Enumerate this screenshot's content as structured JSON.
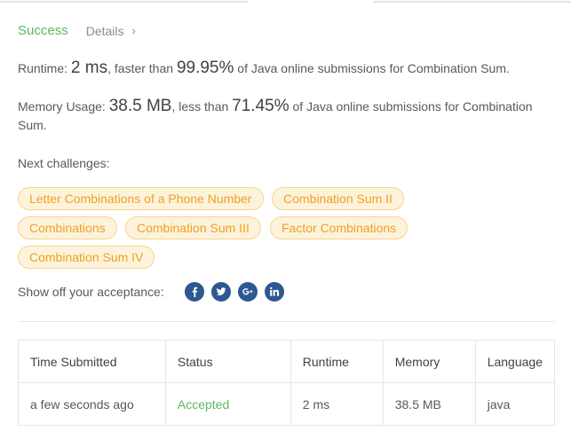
{
  "result": {
    "status": "Success",
    "details_label": "Details",
    "details_chevron": "›"
  },
  "runtime": {
    "label": "Runtime: ",
    "value": "2 ms",
    "mid": ", faster than ",
    "percent": "99.95%",
    "suffix": " of Java online submissions for Combination Sum."
  },
  "memory": {
    "label": "Memory Usage: ",
    "value": "38.5 MB",
    "mid": ", less than ",
    "percent": "71.45%",
    "suffix": " of Java online submissions for Combination Sum."
  },
  "next_challenges": {
    "label": "Next challenges:",
    "items": [
      "Letter Combinations of a Phone Number",
      "Combination Sum II",
      "Combinations",
      "Combination Sum III",
      "Factor Combinations",
      "Combination Sum IV"
    ]
  },
  "share": {
    "label": "Show off your acceptance:",
    "icons": [
      "facebook-icon",
      "twitter-icon",
      "google-plus-icon",
      "linkedin-icon"
    ]
  },
  "submissions": {
    "headers": [
      "Time Submitted",
      "Status",
      "Runtime",
      "Memory",
      "Language"
    ],
    "rows": [
      [
        "a few seconds ago",
        "Accepted",
        "2 ms",
        "38.5 MB",
        "java"
      ]
    ]
  },
  "colors": {
    "success": "#5cb85c",
    "chip_text": "#f0a020",
    "chip_bg": "#fdf3dc",
    "social": "#2d5890"
  }
}
